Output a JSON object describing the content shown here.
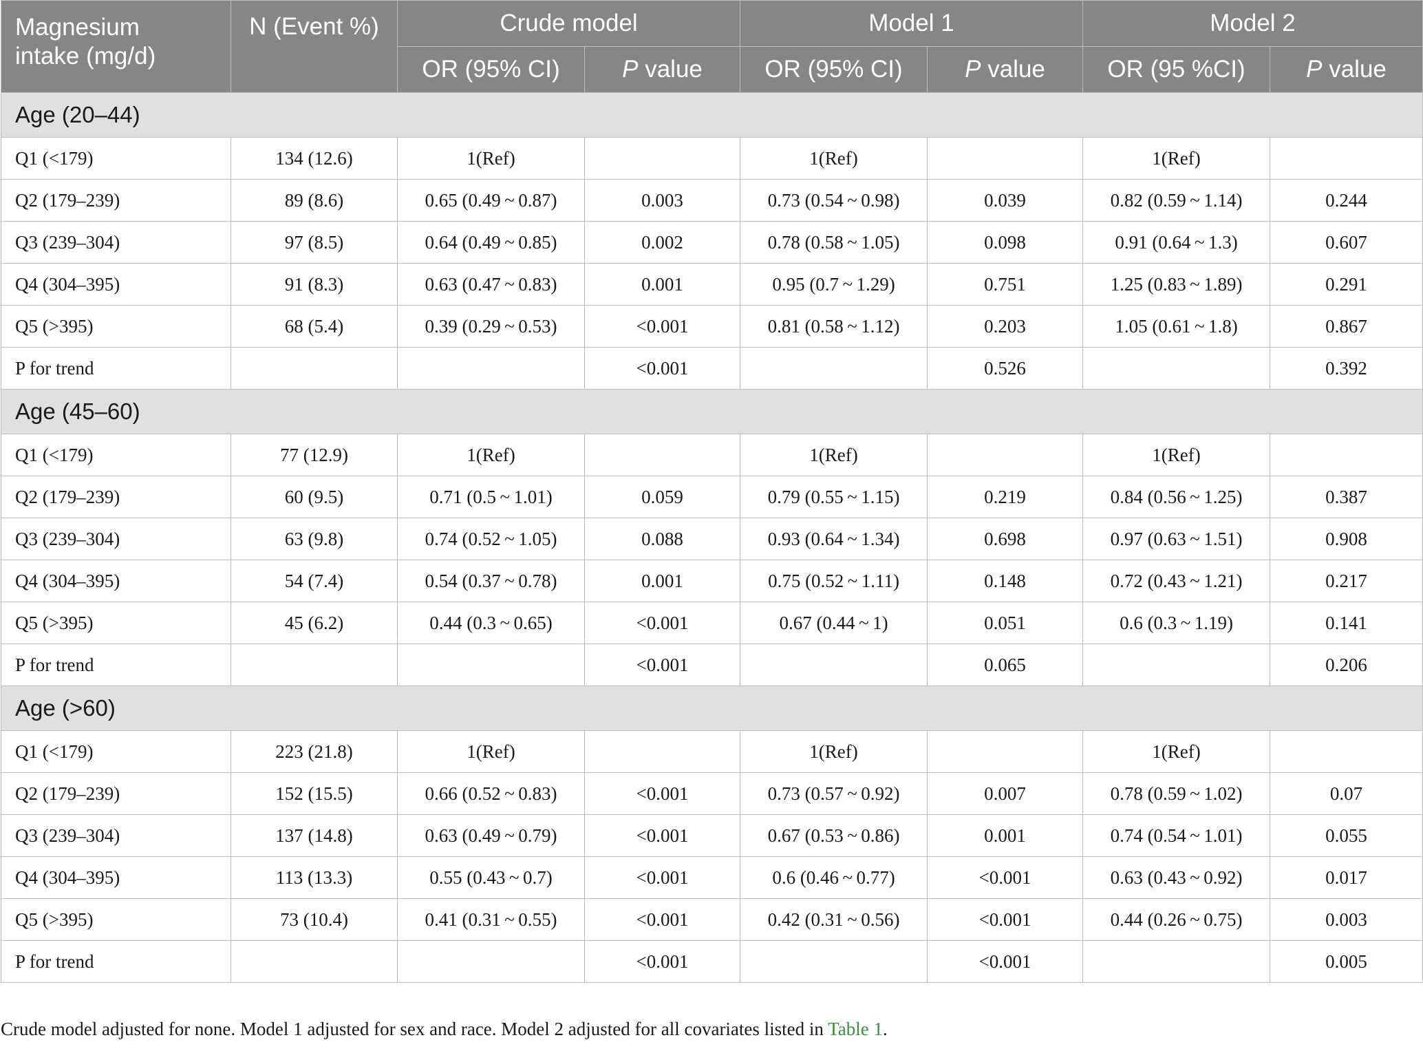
{
  "header": {
    "col1": "Magnesium",
    "col1b": "intake (mg/d)",
    "col2": "N (Event %)",
    "crude": "Crude model",
    "model1": "Model 1",
    "model2": "Model 2",
    "or_crude": "OR (95% CI)",
    "or_m1": "OR (95% CI)",
    "or_m2": "OR (95 %CI)",
    "p_italic": "P",
    "p_rest": " value"
  },
  "sections": [
    {
      "title": "Age (20–44)",
      "rows": [
        [
          "Q1 (<179)",
          "134 (12.6)",
          "1(Ref)",
          "",
          "1(Ref)",
          "",
          "1(Ref)",
          ""
        ],
        [
          "Q2 (179–239)",
          "89 (8.6)",
          "0.65 (0.49 ~ 0.87)",
          "0.003",
          "0.73 (0.54 ~ 0.98)",
          "0.039",
          "0.82 (0.59 ~ 1.14)",
          "0.244"
        ],
        [
          "Q3 (239–304)",
          "97 (8.5)",
          "0.64 (0.49 ~ 0.85)",
          "0.002",
          "0.78 (0.58 ~ 1.05)",
          "0.098",
          "0.91 (0.64 ~ 1.3)",
          "0.607"
        ],
        [
          "Q4 (304–395)",
          "91 (8.3)",
          "0.63 (0.47 ~ 0.83)",
          "0.001",
          "0.95 (0.7 ~ 1.29)",
          "0.751",
          "1.25 (0.83 ~ 1.89)",
          "0.291"
        ],
        [
          "Q5 (>395)",
          "68 (5.4)",
          "0.39 (0.29 ~ 0.53)",
          "<0.001",
          "0.81 (0.58 ~ 1.12)",
          "0.203",
          "1.05 (0.61 ~ 1.8)",
          "0.867"
        ],
        [
          "P for trend",
          "",
          "",
          "<0.001",
          "",
          "0.526",
          "",
          "0.392"
        ]
      ]
    },
    {
      "title": "Age (45–60)",
      "rows": [
        [
          "Q1 (<179)",
          "77 (12.9)",
          "1(Ref)",
          "",
          "1(Ref)",
          "",
          "1(Ref)",
          ""
        ],
        [
          "Q2 (179–239)",
          "60 (9.5)",
          "0.71 (0.5 ~ 1.01)",
          "0.059",
          "0.79 (0.55 ~ 1.15)",
          "0.219",
          "0.84 (0.56 ~ 1.25)",
          "0.387"
        ],
        [
          "Q3 (239–304)",
          "63 (9.8)",
          "0.74 (0.52 ~ 1.05)",
          "0.088",
          "0.93 (0.64 ~ 1.34)",
          "0.698",
          "0.97 (0.63 ~ 1.51)",
          "0.908"
        ],
        [
          "Q4 (304–395)",
          "54 (7.4)",
          "0.54 (0.37 ~ 0.78)",
          "0.001",
          "0.75 (0.52 ~ 1.11)",
          "0.148",
          "0.72 (0.43 ~ 1.21)",
          "0.217"
        ],
        [
          "Q5 (>395)",
          "45 (6.2)",
          "0.44 (0.3 ~ 0.65)",
          "<0.001",
          "0.67 (0.44 ~ 1)",
          "0.051",
          "0.6 (0.3 ~ 1.19)",
          "0.141"
        ],
        [
          "P for trend",
          "",
          "",
          "<0.001",
          "",
          "0.065",
          "",
          "0.206"
        ]
      ]
    },
    {
      "title": "Age (>60)",
      "rows": [
        [
          "Q1 (<179)",
          "223 (21.8)",
          "1(Ref)",
          "",
          "1(Ref)",
          "",
          "1(Ref)",
          ""
        ],
        [
          "Q2 (179–239)",
          "152 (15.5)",
          "0.66 (0.52 ~ 0.83)",
          "<0.001",
          "0.73 (0.57 ~ 0.92)",
          "0.007",
          "0.78 (0.59 ~ 1.02)",
          "0.07"
        ],
        [
          "Q3 (239–304)",
          "137 (14.8)",
          "0.63 (0.49 ~ 0.79)",
          "<0.001",
          "0.67 (0.53 ~ 0.86)",
          "0.001",
          "0.74 (0.54 ~ 1.01)",
          "0.055"
        ],
        [
          "Q4 (304–395)",
          "113 (13.3)",
          "0.55 (0.43 ~ 0.7)",
          "<0.001",
          "0.6 (0.46 ~ 0.77)",
          "<0.001",
          "0.63 (0.43 ~ 0.92)",
          "0.017"
        ],
        [
          "Q5 (>395)",
          "73 (10.4)",
          "0.41 (0.31 ~ 0.55)",
          "<0.001",
          "0.42 (0.31 ~ 0.56)",
          "<0.001",
          "0.44 (0.26 ~ 0.75)",
          "0.003"
        ],
        [
          "P for trend",
          "",
          "",
          "<0.001",
          "",
          "<0.001",
          "",
          "0.005"
        ]
      ]
    }
  ],
  "footnote": {
    "text": "Crude model adjusted for none. Model 1 adjusted for sex and race. Model 2 adjusted for all covariates listed in ",
    "link": "Table 1",
    "end": "."
  }
}
